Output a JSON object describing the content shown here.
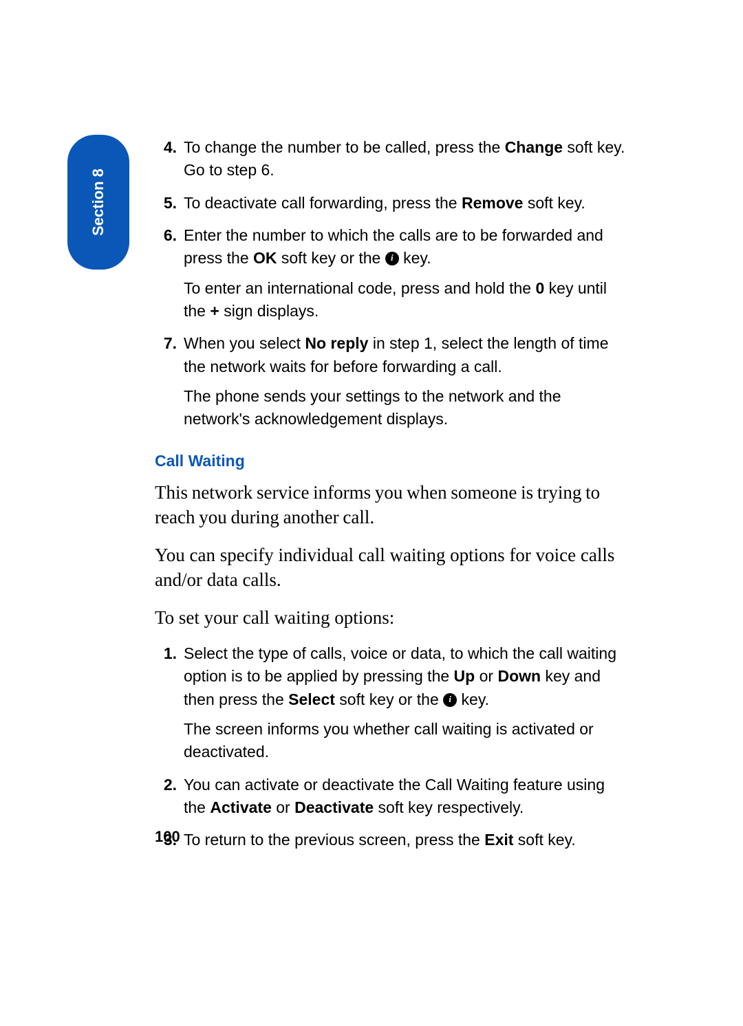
{
  "section_tab": "Section 8",
  "steps_a": [
    {
      "num": "4.",
      "paras": [
        "To change the number to be called, press the <b>Change</b> soft key. Go to step 6."
      ]
    },
    {
      "num": "5.",
      "paras": [
        "To deactivate call forwarding, press the <b>Remove</b> soft key."
      ]
    },
    {
      "num": "6.",
      "paras": [
        "Enter the number to which the calls are to be forwarded and press the <b>OK</b> soft key or the {ICON} key.",
        "To enter an international code, press and hold the <b>0</b> key until the <b>+</b> sign displays."
      ]
    },
    {
      "num": "7.",
      "paras": [
        " When you select <b>No reply</b> in step 1, select the length of time the network waits for before forwarding a call.",
        "The phone sends your settings to the network and the network's acknowledgement displays."
      ]
    }
  ],
  "heading_call_waiting": "Call Waiting",
  "cw_para1": "This network service informs you when someone is trying to reach you during another call.",
  "cw_para2": "You can specify individual call waiting options for voice calls and/or data calls.",
  "cw_para3": "To set your call waiting options:",
  "steps_b": [
    {
      "num": "1.",
      "paras": [
        "Select the type of calls, voice or data, to which the call waiting option is to be applied by pressing the <b>Up</b> or <b>Down</b> key and then press the <b>Select</b> soft key or the {ICON} key.",
        "The screen informs you whether call waiting is activated or deactivated."
      ]
    },
    {
      "num": "2.",
      "paras": [
        "You can activate or deactivate the Call Waiting feature using the <b>Activate</b> or <b>Deactivate</b> soft key respectively."
      ]
    },
    {
      "num": "3.",
      "paras": [
        "To return to the previous screen, press the <b>Exit</b> soft key."
      ]
    }
  ],
  "page_number": "100"
}
